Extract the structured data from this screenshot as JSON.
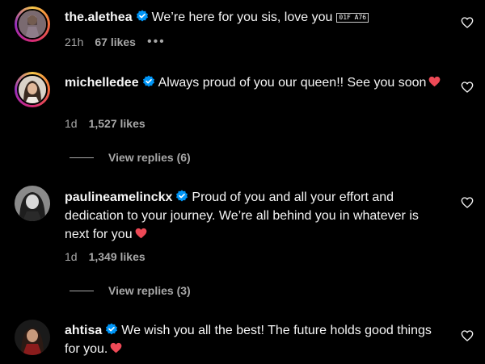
{
  "comments": [
    {
      "username": "the.alethea",
      "text": "We’re here for you sis, love you",
      "emoji_code": "01F A76",
      "time": "21h",
      "likes": "67 likes",
      "more": "•••"
    },
    {
      "username": "michelledee",
      "text": "Always proud of you our queen!! See you soon",
      "time": "1d",
      "likes": "1,527 likes",
      "replies": "View replies (6)"
    },
    {
      "username": "paulineamelinckx",
      "text": "Proud of you and all your effort and dedication to your journey. We’re all behind you in whatever is next for you",
      "time": "1d",
      "likes": "1,349 likes",
      "replies": "View replies (3)"
    },
    {
      "username": "ahtisa",
      "text": "We wish you all the best! The future holds good things for you."
    }
  ],
  "icons": {
    "verified": "verified-badge-icon",
    "like": "heart-outline-icon",
    "emoji_heart": "red-heart-emoji-icon"
  },
  "colors": {
    "background": "#000000",
    "text": "#f5f5f5",
    "muted": "#a8a8a8",
    "verified": "#0095f6",
    "heart": "#ed4956"
  }
}
